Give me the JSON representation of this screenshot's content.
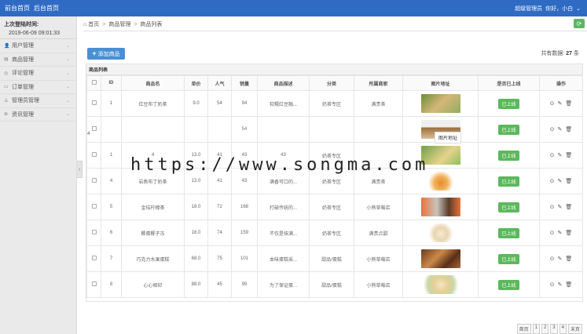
{
  "topbar": {
    "front_home": "前台首页",
    "back_home": "后台首页",
    "admin": "超级管理员",
    "greeting": "你好，小白"
  },
  "sidebar": {
    "last_login_label": "上次登陆时间:",
    "last_login_value": "2019-06-09 09:01:33",
    "items": [
      {
        "label": "用户管理",
        "icon": "user-icon"
      },
      {
        "label": "商品管理",
        "icon": "shop-icon"
      },
      {
        "label": "评论管理",
        "icon": "comment-icon"
      },
      {
        "label": "订单管理",
        "icon": "order-icon"
      },
      {
        "label": "管理员管理",
        "icon": "admin-icon"
      },
      {
        "label": "资讯管理",
        "icon": "news-icon"
      }
    ]
  },
  "breadcrumb": {
    "home": "首页",
    "level2": "商品管理",
    "level3": "商品列表"
  },
  "toolbar": {
    "add_label": "添加商品",
    "total_label": "共有数据:",
    "total_count": "27",
    "total_unit": "条"
  },
  "panel": {
    "title": "商品列表"
  },
  "table": {
    "headers": [
      "ID",
      "商品名",
      "单价",
      "人气",
      "销量",
      "商品描述",
      "分类",
      "所属商家",
      "图片地址",
      "是否已上线",
      "操作"
    ],
    "rows": [
      {
        "id": "1",
        "name": "红豆布丁奶茶",
        "price": "9.0",
        "pop": "54",
        "sales": "94",
        "desc": "软糯红豆融...",
        "cat": "奶茶专区",
        "shop": "满贵茶",
        "img": "t1",
        "online": "已上线"
      },
      {
        "id": "",
        "name": "",
        "price": "",
        "pop": "",
        "sales": "54",
        "desc": "",
        "cat": "",
        "shop": "",
        "img": "t2",
        "online": "已上线"
      },
      {
        "id": "1",
        "name": "4",
        "price": "13.0",
        "pop": "41",
        "sales": "43",
        "desc": "43",
        "cat": "奶茶专区",
        "shop": "",
        "img": "t3",
        "online": "已上线"
      },
      {
        "id": "4",
        "name": "岩焦布丁奶茶",
        "price": "13.0",
        "pop": "41",
        "sales": "43",
        "desc": "满香可口的...",
        "cat": "奶茶专区",
        "shop": "满贵茶",
        "img": "t4",
        "online": "已上线"
      },
      {
        "id": "5",
        "name": "金桔柠檬茶",
        "price": "18.0",
        "pop": "72",
        "sales": "168",
        "desc": "打破传统的...",
        "cat": "奶茶专区",
        "shop": "小熊草莓店",
        "img": "t5",
        "online": "已上线"
      },
      {
        "id": "6",
        "name": "椰蛋椰子冻",
        "price": "18.0",
        "pop": "74",
        "sales": "159",
        "desc": "不仅是抹满...",
        "cat": "奶茶专区",
        "shop": "满贵点甜",
        "img": "t6",
        "online": "已上线"
      },
      {
        "id": "7",
        "name": "巧克力水果蛋糕",
        "price": "68.0",
        "pop": "75",
        "sales": "101",
        "desc": "本味蛋糕采...",
        "cat": "甜品/蛋糕",
        "shop": "小熊草莓店",
        "img": "t7",
        "online": "已上线"
      },
      {
        "id": "8",
        "name": "心心相印",
        "price": "88.0",
        "pop": "45",
        "sales": "99",
        "desc": "为了保证蛋...",
        "cat": "甜品/蛋糕",
        "shop": "小熊草莓店",
        "img": "t8",
        "online": "已上线"
      }
    ],
    "tooltip": "图片地址",
    "stray_digit": "4"
  },
  "pager": [
    "首页",
    "1",
    "2",
    "3",
    "4",
    "末页"
  ],
  "watermark": "https://www.songma.com",
  "colors": {
    "topbar": "#2f6bc3",
    "primary_button": "#4a8fd4",
    "success": "#5cb85c"
  }
}
